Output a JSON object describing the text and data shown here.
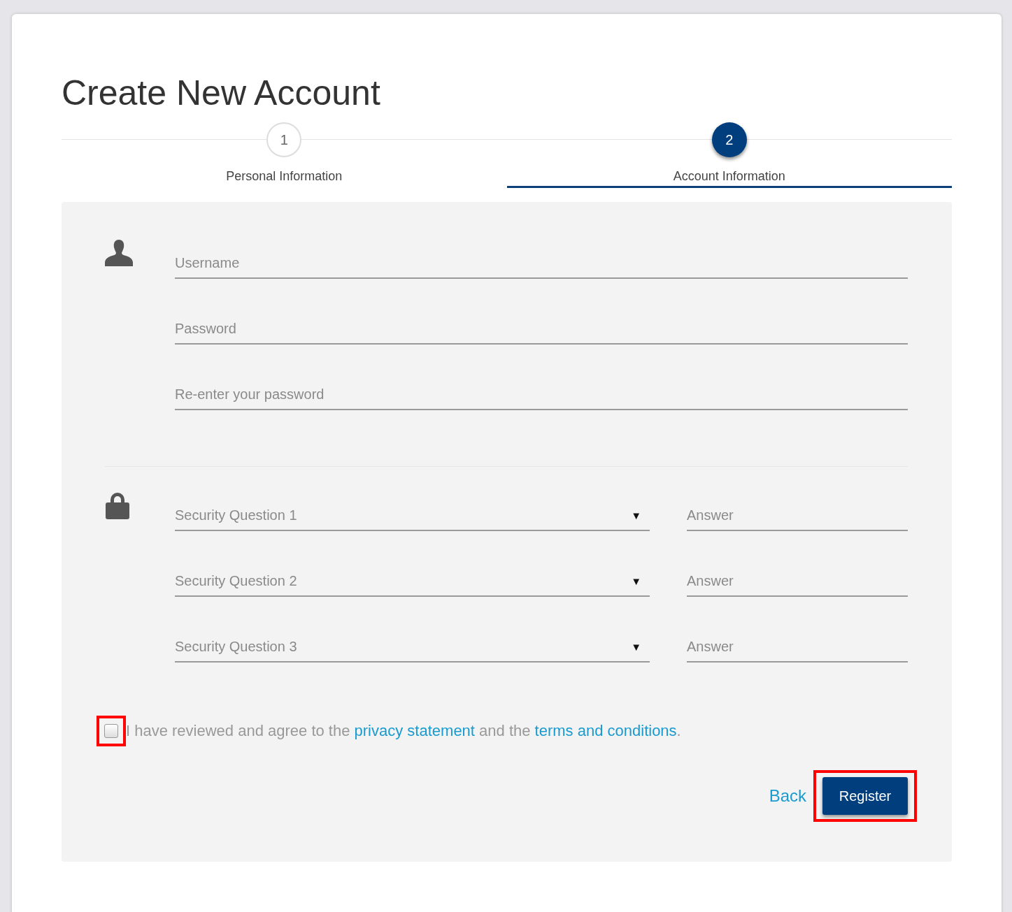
{
  "title": "Create New Account",
  "steps": [
    {
      "number": "1",
      "label": "Personal Information",
      "selected": false
    },
    {
      "number": "2",
      "label": "Account Information",
      "selected": true
    }
  ],
  "account_fields": [
    {
      "placeholder": "Username"
    },
    {
      "placeholder": "Password"
    },
    {
      "placeholder": "Re-enter your password"
    }
  ],
  "security_questions": [
    {
      "placeholder": "Security Question 1",
      "caret": "▼",
      "answer_placeholder": "Answer"
    },
    {
      "placeholder": "Security Question 2",
      "caret": "▼",
      "answer_placeholder": "Answer"
    },
    {
      "placeholder": "Security Question 3",
      "caret": "▼",
      "answer_placeholder": "Answer"
    }
  ],
  "agreement": {
    "checked": false,
    "highlighted": true,
    "text_before": "I have reviewed and agree to the ",
    "link_1": "privacy statement",
    "text_middle": " and the ",
    "link_2": "terms and conditions",
    "text_after": "."
  },
  "back_link": "Back",
  "register_button": {
    "label": "Register",
    "highlighted": true
  }
}
